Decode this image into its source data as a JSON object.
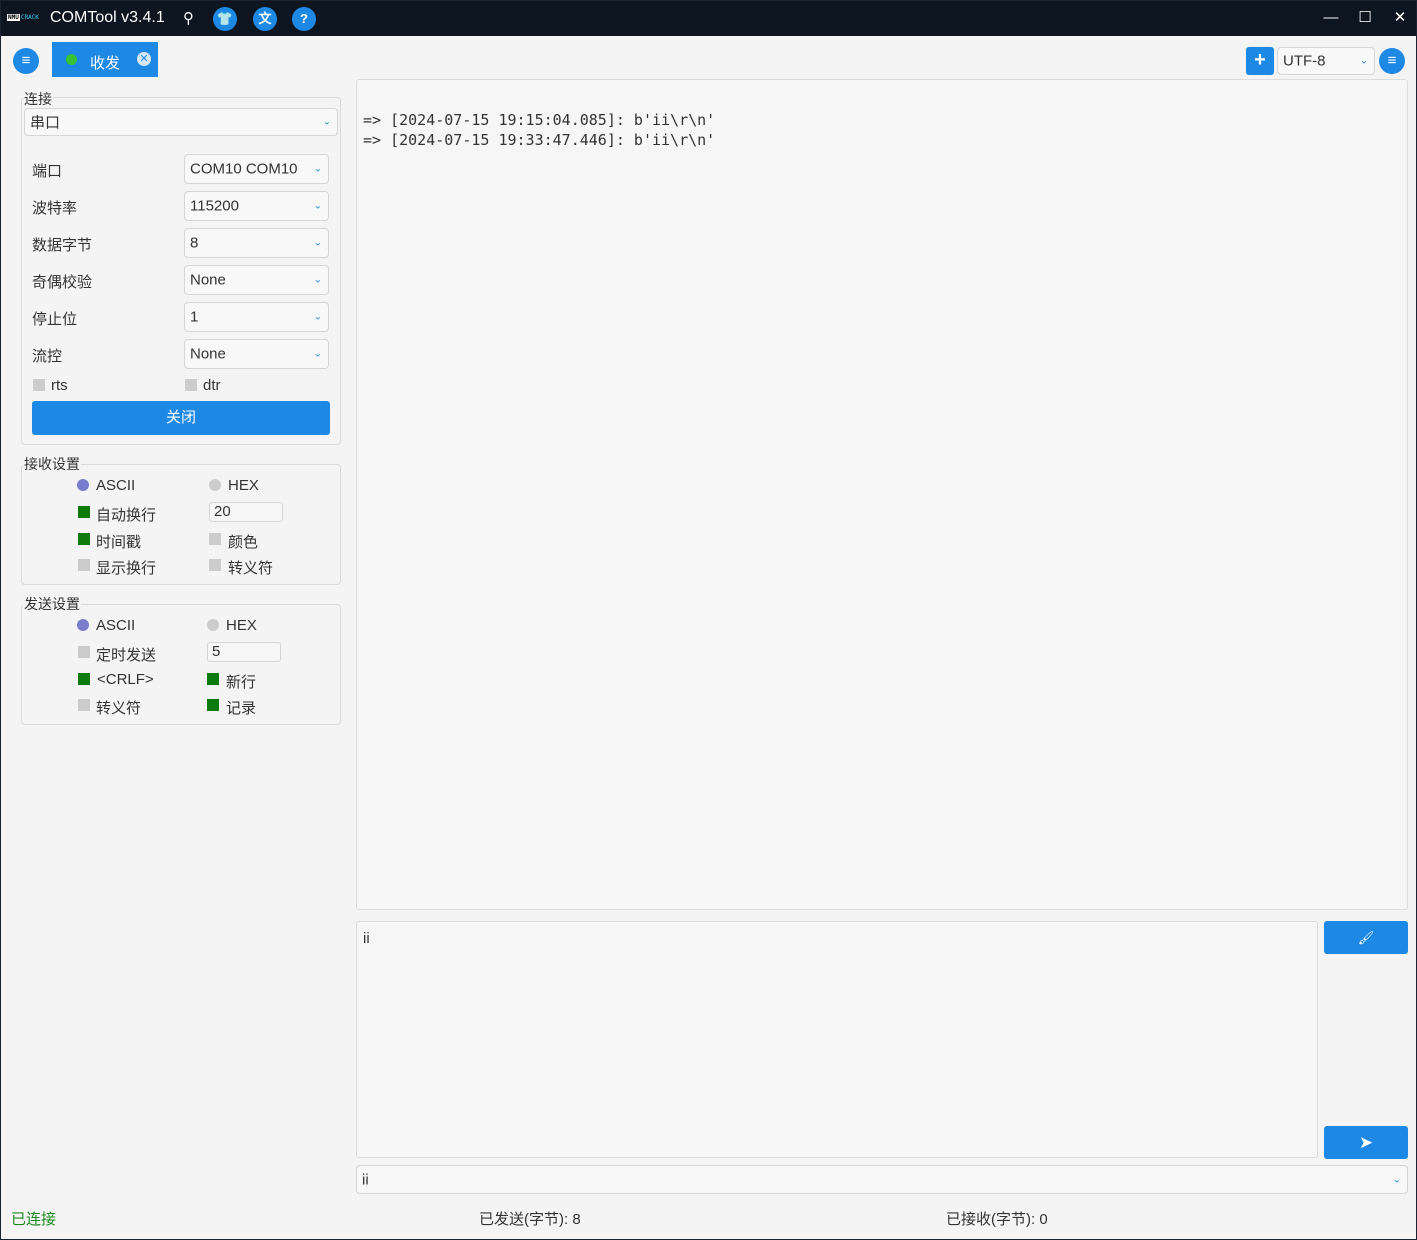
{
  "window": {
    "title": "COMTool v3.4.1",
    "logo_text_a": "NMU",
    "logo_text_b": "CRACK",
    "icons": [
      "pin-icon",
      "skin-icon",
      "translate-icon",
      "help-icon"
    ],
    "pin_glyph": "⚲",
    "skin_glyph": "👕",
    "translate_glyph": "文",
    "help_glyph": "?",
    "minimize_glyph": "—",
    "maximize_glyph": "☐",
    "close_glyph": "✕"
  },
  "toolbar": {
    "menu_glyph": "≡",
    "tab_label": "收发",
    "tab_close_glyph": "✕",
    "add_glyph": "+",
    "encoding": "UTF-8",
    "settings_glyph": "≡"
  },
  "connection": {
    "group_title": "连接",
    "type": "串口",
    "fields": [
      {
        "label": "端口",
        "value": "COM10 COM10"
      },
      {
        "label": "波特率",
        "value": "115200"
      },
      {
        "label": "数据字节",
        "value": "8"
      },
      {
        "label": "奇偶校验",
        "value": "None"
      },
      {
        "label": "停止位",
        "value": "1"
      },
      {
        "label": "流控",
        "value": "None"
      }
    ],
    "rts_label": "rts",
    "rts_checked": false,
    "dtr_label": "dtr",
    "dtr_checked": false,
    "close_button": "关闭"
  },
  "receive_settings": {
    "group_title": "接收设置",
    "ascii_label": "ASCII",
    "hex_label": "HEX",
    "mode": "ASCII",
    "auto_wrap_label": "自动换行",
    "auto_wrap_checked": true,
    "auto_wrap_value": "20",
    "timestamp_label": "时间戳",
    "timestamp_checked": true,
    "color_label": "颜色",
    "color_checked": false,
    "show_newline_label": "显示换行",
    "show_newline_checked": false,
    "escape_label": "转义符",
    "escape_checked": false
  },
  "send_settings": {
    "group_title": "发送设置",
    "ascii_label": "ASCII",
    "hex_label": "HEX",
    "mode": "ASCII",
    "timed_send_label": "定时发送",
    "timed_send_checked": false,
    "timed_send_value": "5",
    "crlf_label": "<CRLF>",
    "crlf_checked": true,
    "newline_label": "新行",
    "newline_checked": true,
    "escape_label": "转义符",
    "escape_checked": false,
    "record_label": "记录",
    "record_checked": true
  },
  "receive_area": {
    "lines": [
      "=> [2024-07-15 19:15:04.085]: b'ii\\r\\n'",
      "=> [2024-07-15 19:33:47.446]: b'ii\\r\\n'"
    ]
  },
  "send_area": {
    "text": "ii",
    "history_value": "ii",
    "clear_glyph": "🖌",
    "send_glyph": "➤"
  },
  "status_bar": {
    "connection_status": "已连接",
    "sent": "已发送(字节): 8",
    "received": "已接收(字节): 0"
  },
  "colors": {
    "accent": "#1e88e5",
    "titlebar": "#0d1520",
    "checked": "#0d7a0d",
    "radio_selected": "#7a7dcc",
    "connected_text": "#1b8a1b"
  }
}
